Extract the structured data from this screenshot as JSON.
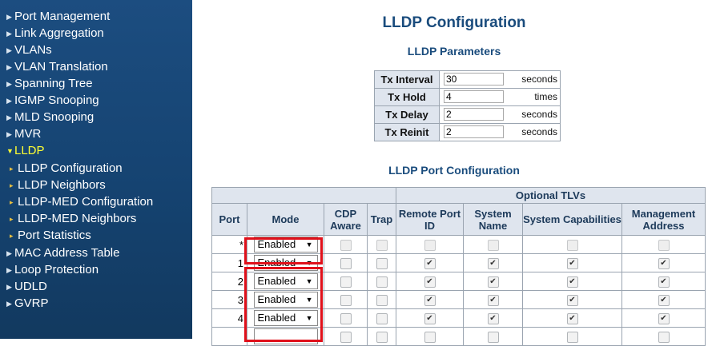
{
  "sidebar": {
    "items": [
      {
        "label": "Port Management"
      },
      {
        "label": "Link Aggregation"
      },
      {
        "label": "VLANs"
      },
      {
        "label": "VLAN Translation"
      },
      {
        "label": "Spanning Tree"
      },
      {
        "label": "IGMP Snooping"
      },
      {
        "label": "MLD Snooping"
      },
      {
        "label": "MVR"
      },
      {
        "label": "LLDP"
      },
      {
        "label": "LLDP Configuration"
      },
      {
        "label": "LLDP Neighbors"
      },
      {
        "label": "LLDP-MED Configuration"
      },
      {
        "label": "LLDP-MED Neighbors"
      },
      {
        "label": "Port Statistics"
      },
      {
        "label": "MAC Address Table"
      },
      {
        "label": "Loop Protection"
      },
      {
        "label": "UDLD"
      },
      {
        "label": "GVRP"
      }
    ],
    "active_color": "#ffff33"
  },
  "main": {
    "title": "LLDP Configuration",
    "parameters_title": "LLDP Parameters",
    "parameters": [
      {
        "label": "Tx Interval",
        "value": "30",
        "unit": "seconds"
      },
      {
        "label": "Tx Hold",
        "value": "4",
        "unit": "times"
      },
      {
        "label": "Tx Delay",
        "value": "2",
        "unit": "seconds"
      },
      {
        "label": "Tx Reinit",
        "value": "2",
        "unit": "seconds"
      }
    ],
    "port_config_title": "LLDP Port Configuration",
    "port_table": {
      "group_header": "Optional TLVs",
      "headers": {
        "port": "Port",
        "mode": "Mode",
        "cdp_aware": "CDP Aware",
        "trap": "Trap",
        "remote_port_id": "Remote Port ID",
        "system_name": "System Name",
        "system_capabilities": "System Capabilities",
        "management_address": "Management Address"
      },
      "rows": [
        {
          "port": "*",
          "mode": "Enabled",
          "cdp": "",
          "trap": "",
          "rpid": "",
          "sname": "",
          "scap": "",
          "maddr": ""
        },
        {
          "port": "1",
          "mode": "Enabled",
          "cdp": "",
          "trap": "",
          "rpid": "✔",
          "sname": "✔",
          "scap": "✔",
          "maddr": "✔"
        },
        {
          "port": "2",
          "mode": "Enabled",
          "cdp": "",
          "trap": "",
          "rpid": "✔",
          "sname": "✔",
          "scap": "✔",
          "maddr": "✔"
        },
        {
          "port": "3",
          "mode": "Enabled",
          "cdp": "",
          "trap": "",
          "rpid": "✔",
          "sname": "✔",
          "scap": "✔",
          "maddr": "✔"
        },
        {
          "port": "4",
          "mode": "Enabled",
          "cdp": "",
          "trap": "",
          "rpid": "✔",
          "sname": "✔",
          "scap": "✔",
          "maddr": "✔"
        },
        {
          "port": "",
          "mode": "",
          "cdp": "",
          "trap": "",
          "rpid": "",
          "sname": "",
          "scap": "",
          "maddr": ""
        }
      ]
    }
  },
  "colors": {
    "sidebar_bg": "#164574",
    "title_color": "#1a4c7d",
    "highlight": "#e0101a"
  }
}
